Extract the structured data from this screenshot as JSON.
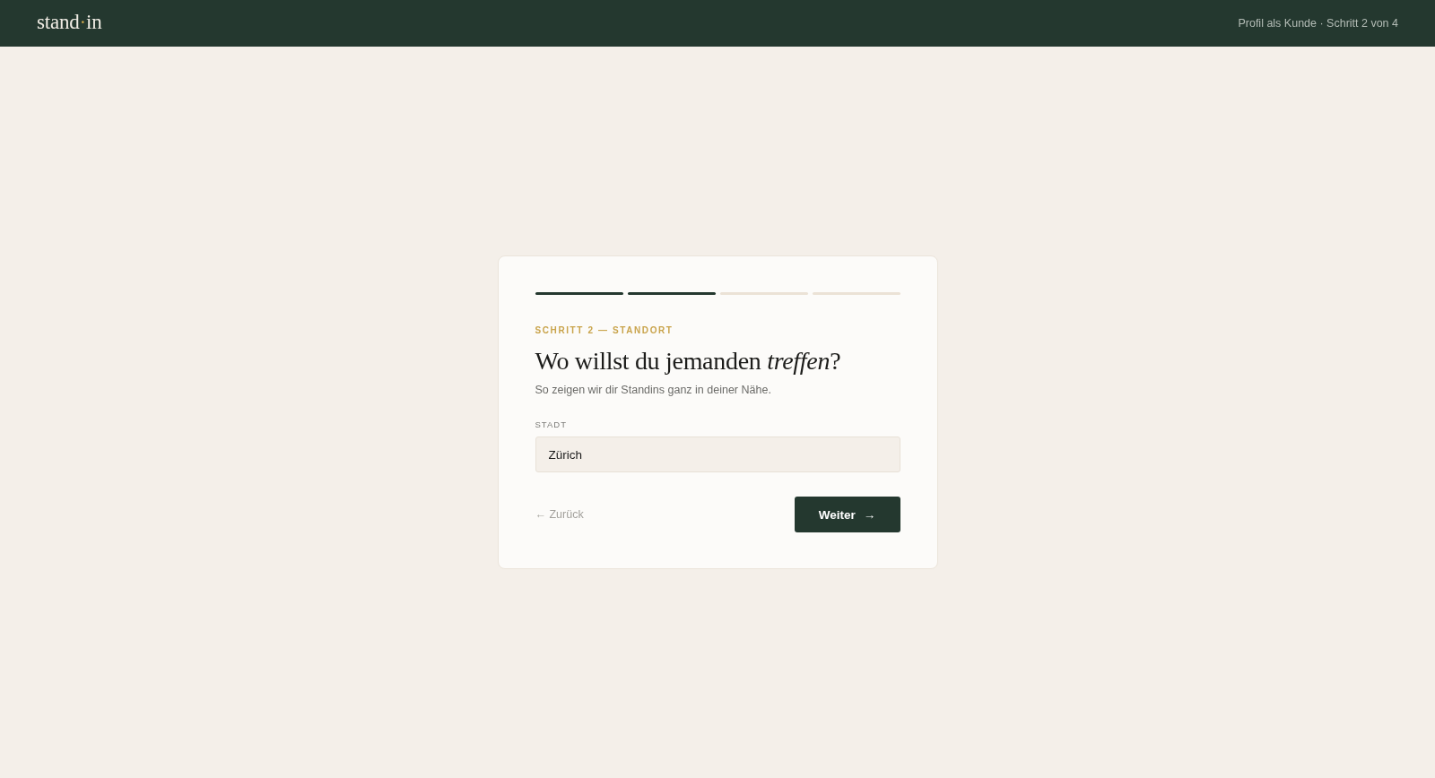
{
  "header": {
    "logo": {
      "before": "stand",
      "dot": "·",
      "after": "in"
    },
    "context": "Profil als Kunde · Schritt 2 von 4"
  },
  "progress": [
    {
      "done": true
    },
    {
      "done": true
    },
    {
      "done": false
    },
    {
      "done": false
    }
  ],
  "step_label": "SCHRITT 2 — STANDORT",
  "title": "Wo willst du jemanden *treffen*?",
  "subtitle": "So zeigen wir dir Standins ganz in deiner Nähe.",
  "field": {
    "label": "STADT",
    "value": "Zürich"
  },
  "back_link": "← Zurück",
  "next_button": {
    "label": "Weiter",
    "arrow": "→"
  }
}
